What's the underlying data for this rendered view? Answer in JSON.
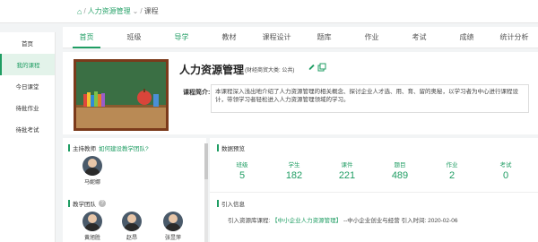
{
  "breadcrumb": {
    "home_icon": "home-icon",
    "sep1": "/",
    "course_link": "人力资源管理",
    "sep2": "/",
    "current": "课程"
  },
  "sidebar": {
    "items": [
      {
        "label": "首页"
      },
      {
        "label": "我的课程"
      },
      {
        "label": "今日课堂"
      },
      {
        "label": "待批作业"
      },
      {
        "label": "待批考试"
      }
    ]
  },
  "tabs": [
    {
      "label": "首页"
    },
    {
      "label": "班级"
    },
    {
      "label": "导学"
    },
    {
      "label": "教材"
    },
    {
      "label": "课程设计"
    },
    {
      "label": "题库"
    },
    {
      "label": "作业"
    },
    {
      "label": "考试"
    },
    {
      "label": "成绩"
    },
    {
      "label": "统计分析"
    }
  ],
  "course": {
    "title": "人力资源管理",
    "category": "(财经商贸大类: 公共)",
    "intro_label": "课程简介:",
    "intro_text": "本课程深入浅出地介绍了人力资源管理的相关概念、探讨企业人才选、用、育、留的奥秘，以学习者为中心进行课程设计，带领学习者轻松进入人力资源管理领域的学习。"
  },
  "teacher": {
    "label": "主持教师",
    "link": "如何建设教学团队?",
    "name": "马妮娜"
  },
  "team": {
    "label": "教学团队",
    "members": [
      {
        "name": "黄旭胜"
      },
      {
        "name": "赵昂"
      },
      {
        "name": "张昱萍"
      }
    ]
  },
  "stats": {
    "title": "数据预览",
    "items": [
      {
        "label": "班级",
        "value": "5"
      },
      {
        "label": "学生",
        "value": "182"
      },
      {
        "label": "课件",
        "value": "221"
      },
      {
        "label": "题目",
        "value": "489"
      },
      {
        "label": "作业",
        "value": "2"
      },
      {
        "label": "考试",
        "value": "0"
      }
    ]
  },
  "reference": {
    "title": "引入信息",
    "label": "引入资源库课程:",
    "link": "【中小企业人力资源管理】",
    "suffix": "--中小企业创业与经营 引入时间: 2020-02-06"
  },
  "colors": {
    "accent": "#1f9d63",
    "accent_light": "#e3f3ea"
  }
}
